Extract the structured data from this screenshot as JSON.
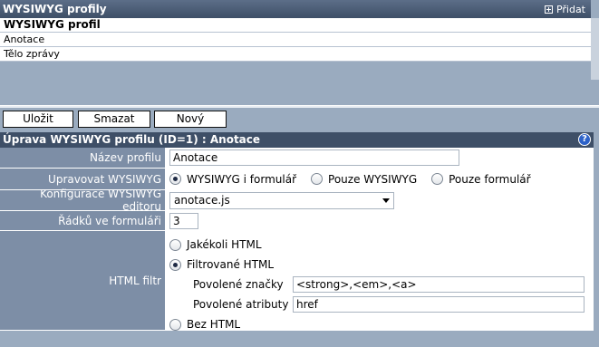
{
  "list": {
    "title": "WYSIWYG profily",
    "add_label": "Přidat",
    "header_item": "WYSIWYG profil",
    "items": [
      "Anotace",
      "Tělo zprávy"
    ]
  },
  "buttons": {
    "save": "Uložit",
    "delete": "Smazat",
    "new": "Nový"
  },
  "form": {
    "title": "Úprava WYSIWYG profilu (ID=1) : Anotace",
    "help": "?",
    "name_label": "Název profilu",
    "name_value": "Anotace",
    "edit_label": "Upravovat WYSIWYG",
    "edit_options": [
      "WYSIWYG i formulář",
      "Pouze WYSIWYG",
      "Pouze formulář"
    ],
    "edit_selected": "WYSIWYG i formulář",
    "config_label": "Konfigurace WYSIWYG editoru",
    "config_value": "anotace.js",
    "rows_label": "Řádků ve formuláři",
    "rows_value": "3",
    "filter_label": "HTML filtr",
    "filter_options": [
      "Jakékoli HTML",
      "Filtrované HTML",
      "Bez HTML"
    ],
    "filter_selected": "Filtrované HTML",
    "allowed_tags_label": "Povolené značky",
    "allowed_tags_value": "<strong>,<em>,<a>",
    "allowed_attrs_label": "Povolené atributy",
    "allowed_attrs_value": "href"
  },
  "colors": {
    "header_dark": "#3e4f67",
    "label_bg": "#7d8ea6",
    "page_bg": "#9aabbf",
    "help_blue": "#2d62c8"
  }
}
